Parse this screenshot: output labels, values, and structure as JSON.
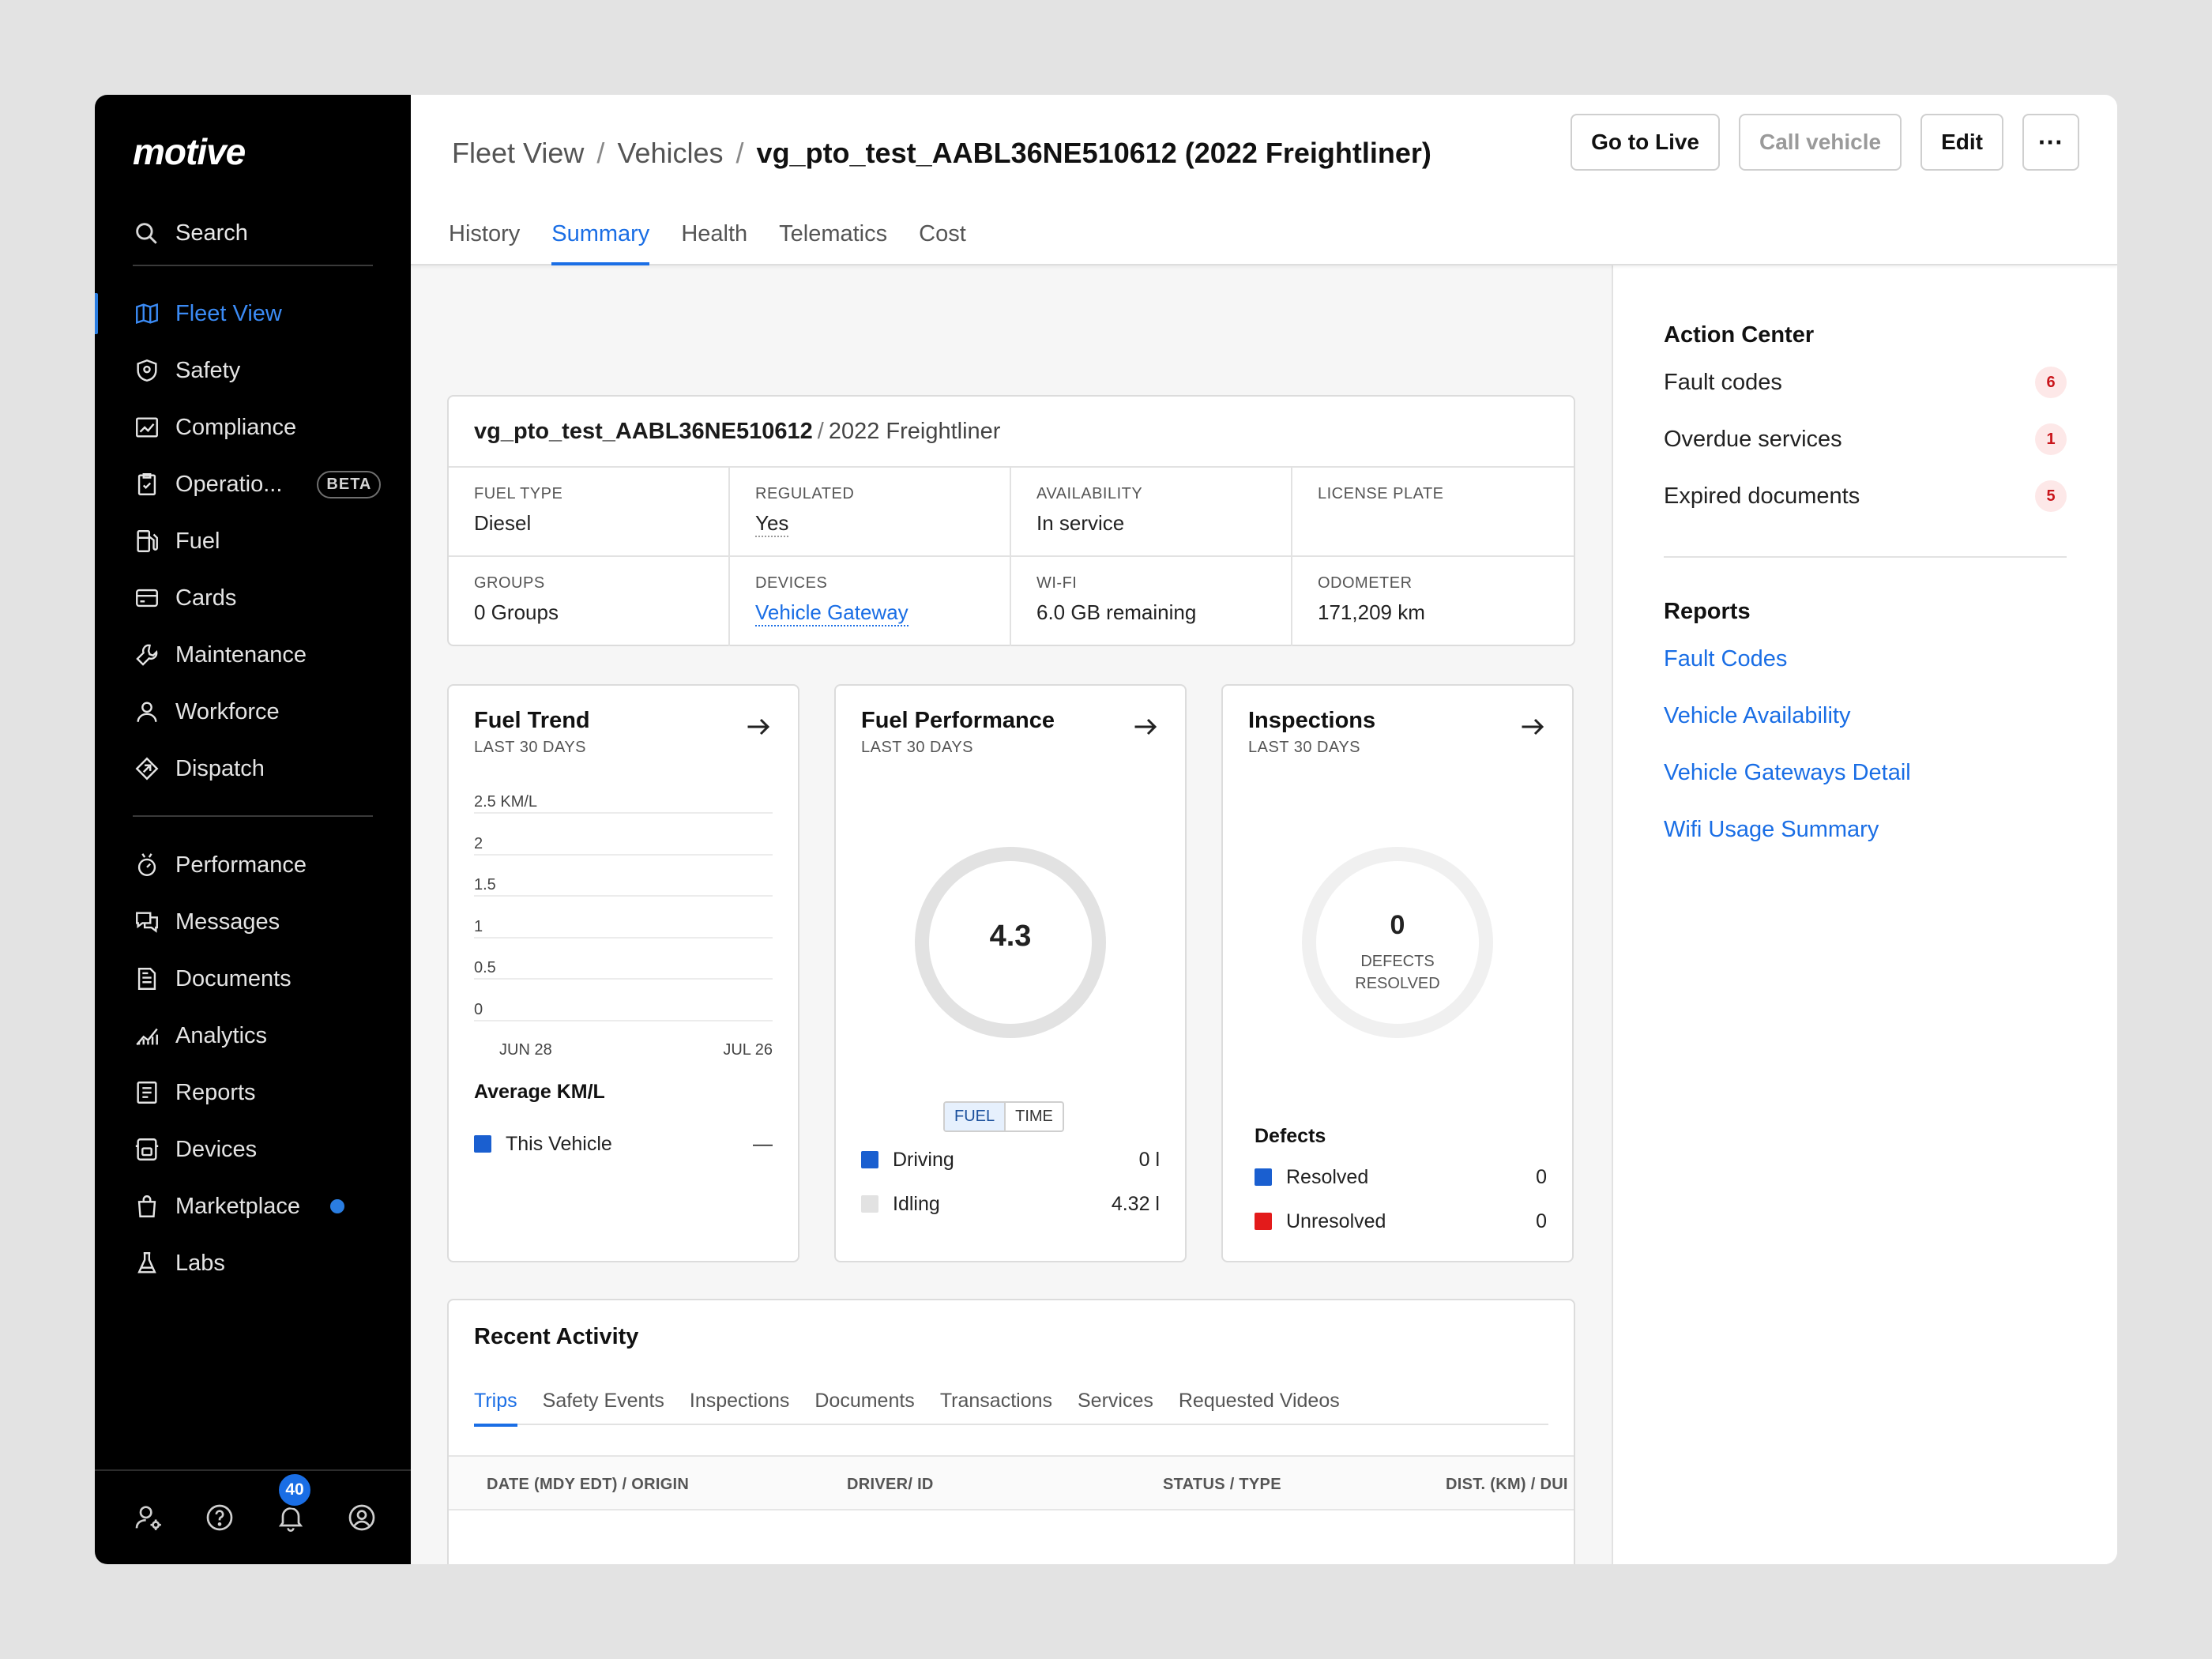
{
  "app": {
    "logo": "motive"
  },
  "sidebar": {
    "search_label": "Search",
    "nav_primary": [
      {
        "label": "Fleet View",
        "icon": "map-icon",
        "active": true
      },
      {
        "label": "Safety",
        "icon": "shield-icon"
      },
      {
        "label": "Compliance",
        "icon": "compliance-icon"
      },
      {
        "label": "Operatio...",
        "icon": "clipboard-icon",
        "badge": "BETA"
      },
      {
        "label": "Fuel",
        "icon": "fuel-icon"
      },
      {
        "label": "Cards",
        "icon": "card-icon"
      },
      {
        "label": "Maintenance",
        "icon": "wrench-icon"
      },
      {
        "label": "Workforce",
        "icon": "person-icon"
      },
      {
        "label": "Dispatch",
        "icon": "dispatch-icon"
      }
    ],
    "nav_secondary": [
      {
        "label": "Performance",
        "icon": "performance-icon"
      },
      {
        "label": "Messages",
        "icon": "messages-icon"
      },
      {
        "label": "Documents",
        "icon": "document-icon"
      },
      {
        "label": "Analytics",
        "icon": "analytics-icon"
      },
      {
        "label": "Reports",
        "icon": "reports-icon"
      },
      {
        "label": "Devices",
        "icon": "devices-icon"
      },
      {
        "label": "Marketplace",
        "icon": "bag-icon",
        "dot": true
      },
      {
        "label": "Labs",
        "icon": "flask-icon"
      }
    ],
    "footer": {
      "notification_count": "40"
    }
  },
  "header": {
    "breadcrumb": [
      "Fleet View",
      "Vehicles",
      "vg_pto_test_AABL36NE510612 (2022 Freightliner)"
    ],
    "actions": {
      "go_live": "Go to Live",
      "call_vehicle": "Call vehicle",
      "edit": "Edit",
      "more": "···"
    },
    "tabs": [
      "History",
      "Summary",
      "Health",
      "Telematics",
      "Cost"
    ],
    "active_tab": "Summary"
  },
  "vehicle": {
    "name": "vg_pto_test_AABL36NE510612",
    "model": "2022 Freightliner",
    "fields": [
      {
        "label": "FUEL TYPE",
        "value": "Diesel"
      },
      {
        "label": "REGULATED",
        "value": "Yes",
        "style": "dotted"
      },
      {
        "label": "AVAILABILITY",
        "value": "In service"
      },
      {
        "label": "LICENSE PLATE",
        "value": ""
      },
      {
        "label": "GROUPS",
        "value": "0 Groups"
      },
      {
        "label": "DEVICES",
        "value": "Vehicle Gateway",
        "style": "link"
      },
      {
        "label": "WI-FI",
        "value": "6.0 GB remaining"
      },
      {
        "label": "ODOMETER",
        "value": "171,209 km"
      }
    ]
  },
  "fuel_trend": {
    "title": "Fuel Trend",
    "subtitle": "LAST 30 DAYS",
    "y_ticks": [
      "2.5 KM/L",
      "2",
      "1.5",
      "1",
      "0.5",
      "0"
    ],
    "x_ticks": [
      "JUN 28",
      "JUL 26"
    ],
    "avg_title": "Average KM/L",
    "legend": {
      "label": "This Vehicle",
      "value": "—",
      "color": "#1a5fd0"
    }
  },
  "fuel_performance": {
    "title": "Fuel Performance",
    "subtitle": "LAST 30 DAYS",
    "center_value": "4.3",
    "toggle": [
      "FUEL",
      "TIME"
    ],
    "legend": [
      {
        "label": "Driving",
        "value": "0 l",
        "color": "#1a5fd0"
      },
      {
        "label": "Idling",
        "value": "4.32 l",
        "color": "#e2e2e2"
      }
    ]
  },
  "inspections": {
    "title": "Inspections",
    "subtitle": "LAST 30 DAYS",
    "center_value": "0",
    "center_label_1": "DEFECTS",
    "center_label_2": "RESOLVED",
    "defects_title": "Defects",
    "legend": [
      {
        "label": "Resolved",
        "value": "0",
        "color": "#1a5fd0"
      },
      {
        "label": "Unresolved",
        "value": "0",
        "color": "#e31b1b"
      }
    ]
  },
  "recent_activity": {
    "title": "Recent Activity",
    "tabs": [
      "Trips",
      "Safety Events",
      "Inspections",
      "Documents",
      "Transactions",
      "Services",
      "Requested Videos"
    ],
    "active_tab": "Trips",
    "columns": [
      "DATE (MDY EDT) / ORIGIN",
      "DRIVER/ ID",
      "STATUS / TYPE",
      "DIST. (KM) / DUI"
    ]
  },
  "right_panel": {
    "action_center_title": "Action Center",
    "action_items": [
      {
        "label": "Fault codes",
        "count": "6"
      },
      {
        "label": "Overdue services",
        "count": "1"
      },
      {
        "label": "Expired documents",
        "count": "5"
      }
    ],
    "reports_title": "Reports",
    "reports": [
      "Fault Codes",
      "Vehicle Availability",
      "Vehicle Gateways Detail",
      "Wifi Usage Summary"
    ]
  }
}
